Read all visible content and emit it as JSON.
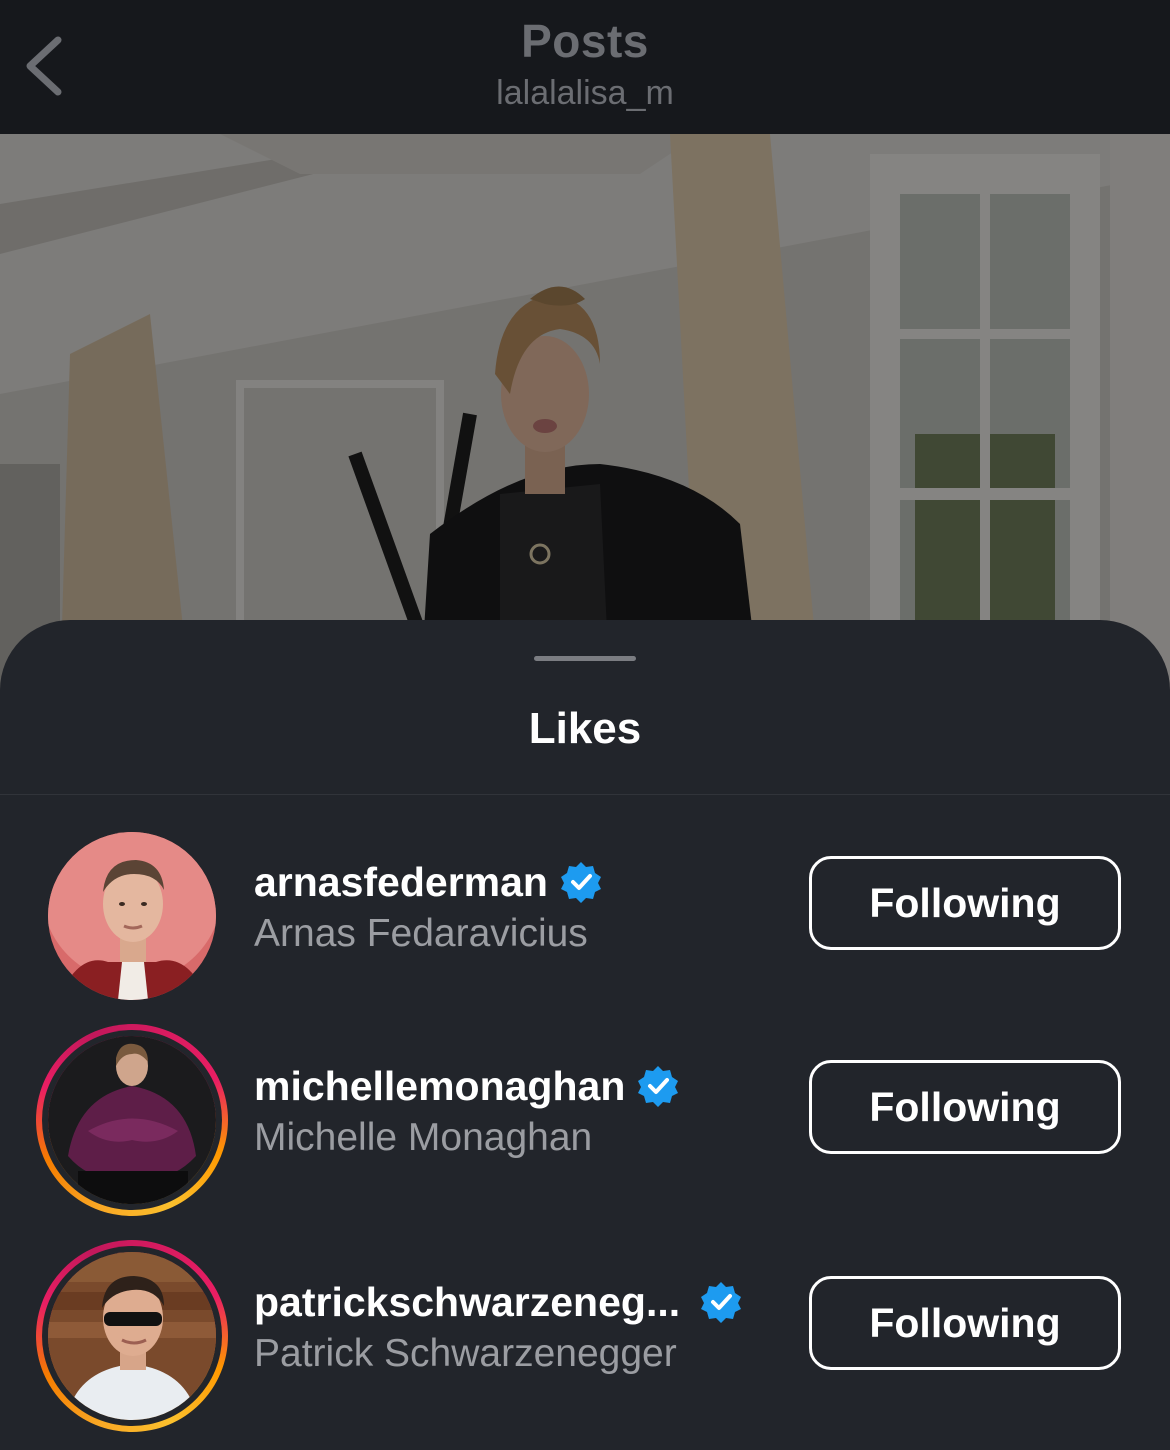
{
  "nav": {
    "title": "Posts",
    "subtitle": "lalalalisa_m",
    "back_icon": "chevron-left-icon"
  },
  "post": {
    "image_description_icon": "post-photo"
  },
  "likes_sheet": {
    "title": "Likes",
    "users": [
      {
        "username": "arnasfederman",
        "full_name": "Arnas Fedaravicius",
        "verified": true,
        "has_story_ring": false,
        "button_label": "Following"
      },
      {
        "username": "michellemonaghan",
        "full_name": "Michelle Monaghan",
        "verified": true,
        "has_story_ring": true,
        "button_label": "Following"
      },
      {
        "username": "patrickschwarzeneg...",
        "full_name": "Patrick Schwarzenegger",
        "verified": true,
        "has_story_ring": true,
        "button_label": "Following"
      }
    ]
  },
  "colors": {
    "sheet_background": "#22252b",
    "verified_blue": "#1d9bf0",
    "secondary_text": "#9b9da2"
  }
}
